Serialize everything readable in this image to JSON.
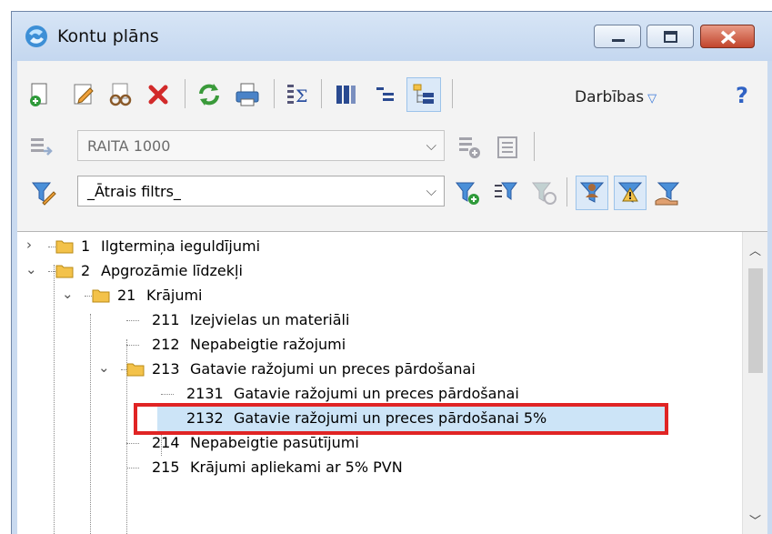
{
  "window": {
    "title": "Kontu plāns"
  },
  "toolbar": {
    "actions_label": "Darbības",
    "actions_arrow": "▽",
    "help_icon": "?"
  },
  "journal": {
    "selected": "RAITA 1000"
  },
  "filter": {
    "selected": "_Ātrais filtrs_"
  },
  "tree": {
    "rows": [
      {
        "code": "1",
        "name": "Ilgtermiņa ieguldījumi"
      },
      {
        "code": "2",
        "name": "Apgrozāmie līdzekļi"
      },
      {
        "code": "21",
        "name": "Krājumi"
      },
      {
        "code": "211",
        "name": "Izejvielas un materiāli"
      },
      {
        "code": "212",
        "name": "Nepabeigtie ražojumi"
      },
      {
        "code": "213",
        "name": "Gatavie ražojumi un preces pārdošanai"
      },
      {
        "code": "2131",
        "name": "Gatavie ražojumi un preces pārdošanai"
      },
      {
        "code": "2132",
        "name": "Gatavie ražojumi un preces pārdošanai 5%"
      },
      {
        "code": "214",
        "name": "Nepabeigtie pasūtījumi"
      },
      {
        "code": "215",
        "name": "Krājumi apliekami ar 5% PVN"
      }
    ]
  },
  "colors": {
    "selection": "#cce4f7",
    "highlight": "#e02424",
    "folder": "#f3c24a"
  }
}
